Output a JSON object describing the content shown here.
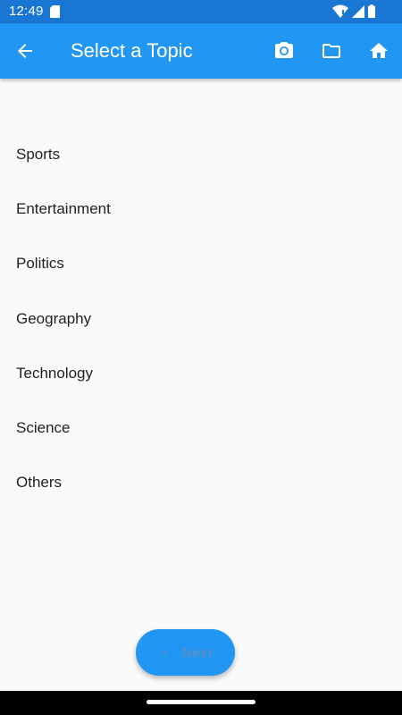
{
  "status_bar": {
    "time": "12:49",
    "icons": [
      "sd-card-icon",
      "wifi-icon",
      "signal-icon",
      "battery-icon"
    ]
  },
  "app_bar": {
    "title": "Select a Topic",
    "actions": [
      "camera-icon",
      "folder-icon",
      "home-icon"
    ]
  },
  "topics": [
    "Sports",
    "Entertainment",
    "Politics",
    "Geography",
    "Technology",
    "Science",
    "Others"
  ],
  "next_button": {
    "label": "Next",
    "icon": "chevron-right-icon"
  },
  "colors": {
    "app_bar": "#2196f3",
    "status_bar": "#1976d2",
    "background": "#fafafa",
    "fab_label": "#5d8fc4"
  }
}
